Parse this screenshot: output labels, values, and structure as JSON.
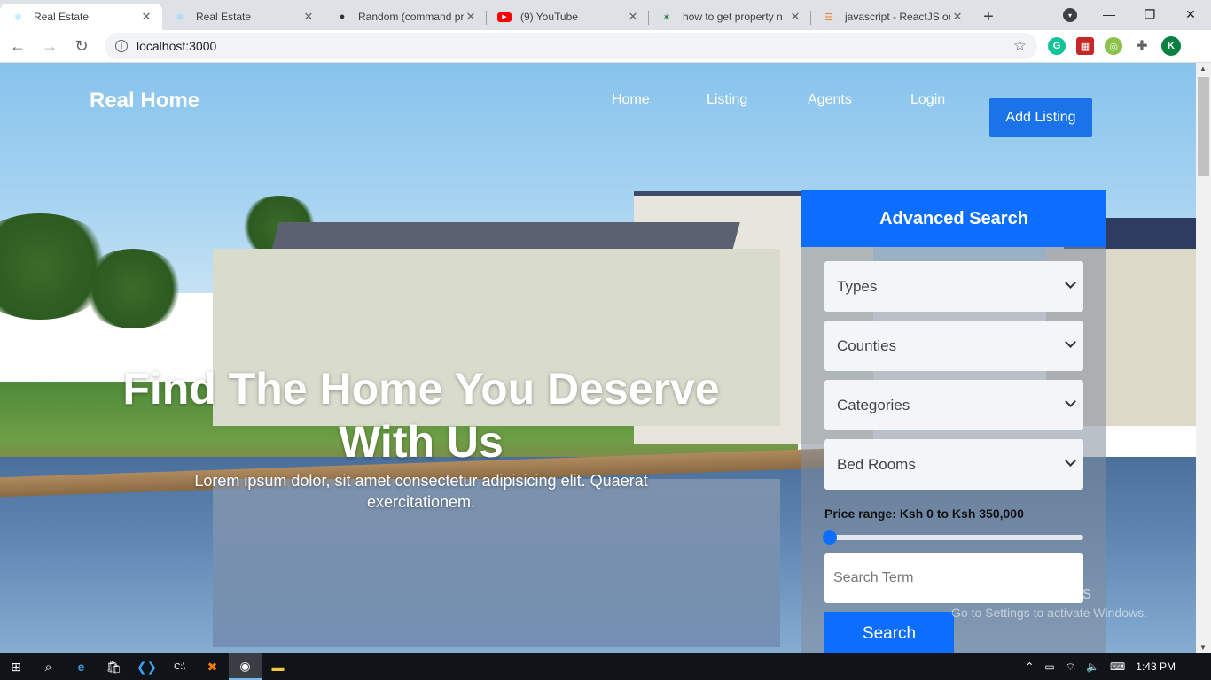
{
  "browser": {
    "tabs": [
      {
        "title": "Real Estate",
        "icon": "react-icon",
        "active": true
      },
      {
        "title": "Real Estate",
        "icon": "react-icon",
        "active": false
      },
      {
        "title": "Random (command pr",
        "icon": "github-icon",
        "active": false
      },
      {
        "title": "(9) YouTube",
        "icon": "youtube-icon",
        "active": false
      },
      {
        "title": "how to get property n",
        "icon": "site-icon",
        "active": false
      },
      {
        "title": "javascript - ReactJS on",
        "icon": "stackoverflow-icon",
        "active": false
      }
    ],
    "url": "localhost:3000",
    "profile_initial": "K"
  },
  "site": {
    "brand": "Real Home",
    "nav": [
      "Home",
      "Listing",
      "Agents",
      "Login"
    ],
    "add_listing": "Add Listing",
    "headline": "Find The Home You Deserve With Us",
    "subline": "Lorem ipsum dolor, sit amet consectetur adipisicing elit. Quaerat exercitationem."
  },
  "search_panel": {
    "title": "Advanced Search",
    "selects": [
      "Types",
      "Counties",
      "Categories",
      "Bed Rooms"
    ],
    "price_label": "Price range: Ksh 0 to Ksh 350,000",
    "price_min": 0,
    "price_max": 350000,
    "slider_value_fraction": 0,
    "search_placeholder": "Search Term",
    "search_button": "Search"
  },
  "watermark": {
    "line1": "Activate Windows",
    "line2": "Go to Settings to activate Windows."
  },
  "taskbar": {
    "time": "1:43 PM"
  }
}
